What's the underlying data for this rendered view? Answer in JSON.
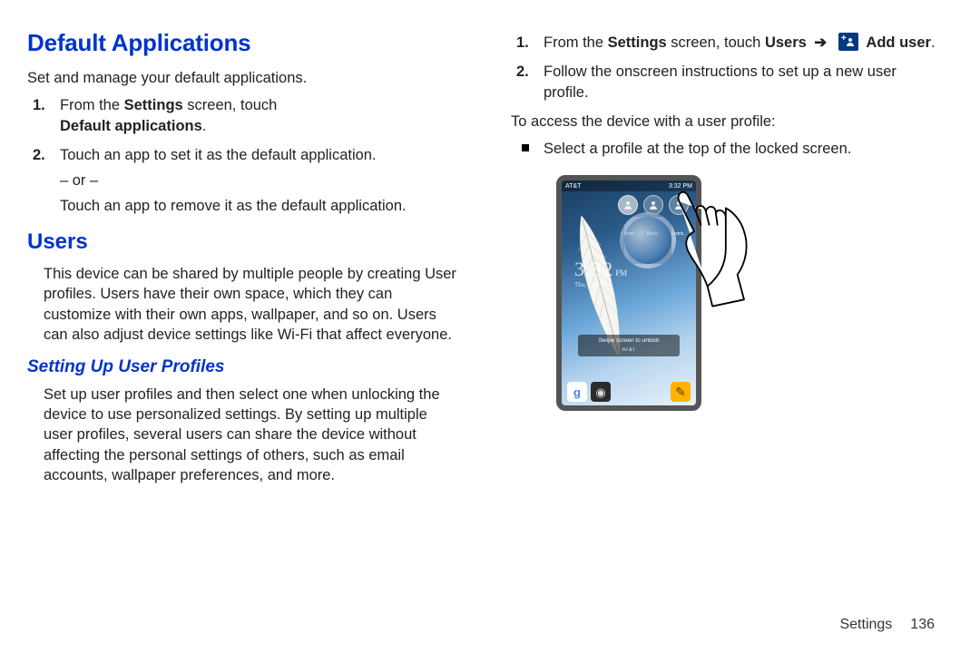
{
  "left": {
    "h1": "Default Applications",
    "p_intro": "Set and manage your default applications.",
    "step1_a": "From the ",
    "step1_b_bold": "Settings",
    "step1_c": " screen, touch ",
    "step1_d_bold": "Default applications",
    "step1_e": ".",
    "step2_a": "Touch an app to set it as the default application.",
    "step2_or": "– or –",
    "step2_b": "Touch an app to remove it as the default application.",
    "h2_users": "Users",
    "users_body": "This device can be shared by multiple people by creating User profiles. Users have their own space, which they can customize with their own apps, wallpaper, and so on. Users can also adjust device settings like Wi-Fi that affect everyone.",
    "h3_setup": "Setting Up User Profiles",
    "setup_body": "Set up user profiles and then select one when unlocking the device to use personalized settings. By setting up multiple user profiles, several users can share the device without affecting the personal settings of others, such as email accounts, wallpaper preferences, and more."
  },
  "right": {
    "r_step1_a": "From the ",
    "r_step1_b_bold": "Settings",
    "r_step1_c": " screen, touch ",
    "r_step1_d_bold": "Users",
    "r_step1_arrow": "➔",
    "r_step1_e_bold": "Add user",
    "r_step1_f": ".",
    "r_step2": "Follow the onscreen instructions to set up a new user profile.",
    "access_line": "To access the device with a user profile:",
    "bullet": "Select a profile at the top of the locked screen.",
    "device": {
      "status_left": "AT&T",
      "status_right": "3:32 PM",
      "profile1": "Owner",
      "profile2": "Restr..",
      "profile3": "restric..",
      "clock_time": "3:32",
      "clock_ampm": "PM",
      "clock_date": "Thu, June 5",
      "unlock_text": "Swipe screen to unlock",
      "carrier": "AT&T",
      "dock_g": "g",
      "dock_cam": "◉",
      "dock_mem": "✎"
    }
  },
  "footer": {
    "section": "Settings",
    "page": "136"
  }
}
